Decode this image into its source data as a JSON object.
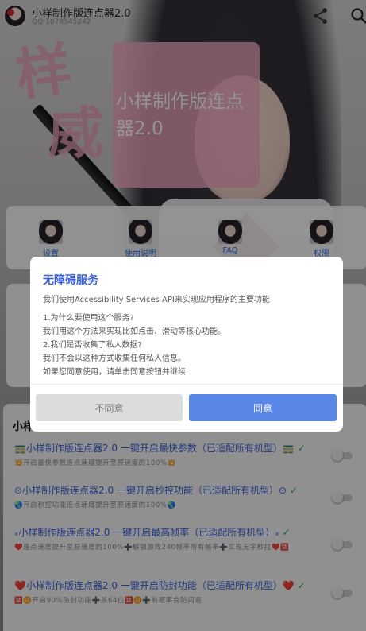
{
  "app": {
    "title": "小样制作版连点器2.0",
    "subtitle": "QQ:1078545242"
  },
  "icons": {
    "share": "share-icon",
    "search": "search-icon"
  },
  "background": {
    "stamp": [
      "样",
      "威"
    ],
    "card_text": "小样制作版连点器2.0"
  },
  "quick": [
    {
      "label": "设置"
    },
    {
      "label": "使用说明"
    },
    {
      "label": "FAQ"
    },
    {
      "label": "权限"
    }
  ],
  "list": {
    "header": "小样",
    "items": [
      {
        "title": "🚃小样制作版连点器2.0 一键开启最快参数（已适配所有机型）🚃",
        "desc": "💥开启最快参数连点速度提升至原速度的100%💥",
        "enabled": false
      },
      {
        "title": "⊙小样制作版连点器2.0 一键开启秒控功能（已适配所有机型）⊙",
        "desc": "🌏开启秒控功能连点速度提升至原速度的100%🌏",
        "enabled": false
      },
      {
        "title": "ₓ小样制作版连点器2.0 一键开启最高帧率（已适配所有机型）ₓ",
        "desc": "❤️连点速度提升至原速度的100%➕解锁游戏240帧率所有帧率➕实现无字秒拉❤️🈲",
        "enabled": false
      },
      {
        "title": "❤️小样制作版连点器2.0 一键开启防封功能（已适配所有机型）❤️",
        "desc": "🈲🉑开启90%防封功能➕杀64位🈲🉑➕有概率会防闪退",
        "enabled": false
      }
    ]
  },
  "dialog": {
    "title": "无障碍服务",
    "intro": "我们使用Accessibility Services API来实现应用程序的主要功能",
    "lines": [
      "1.为什么要使用这个服务?",
      "我们用这个方法来实现比如点击、滑动等核心功能。",
      "2.我们是否收集了私人数据?",
      "我们不会以这种方式收集任何私人信息。",
      "如果您同意使用，请单击同意按钮并继续"
    ],
    "disagree": "不同意",
    "agree": "同意"
  },
  "colors": {
    "accent": "#5a86e8",
    "title_blue": "#3a5fd9",
    "check_green": "#2bb05a",
    "card_pink": "#f5aac3"
  }
}
